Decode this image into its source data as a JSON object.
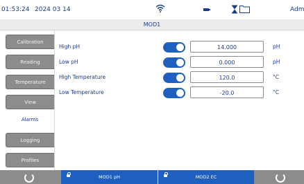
{
  "status": {
    "time": "01:53:24",
    "date": "2024 03 14",
    "user": "Adm"
  },
  "icons": {
    "wifi": "wifi-icon",
    "battery": "battery-icon",
    "hourglass": "hourglass-icon",
    "folder": "folder-icon"
  },
  "title": "MOD1",
  "sidebar": {
    "items": [
      {
        "label": "Calibration"
      },
      {
        "label": "Reading"
      },
      {
        "label": "Temperature"
      },
      {
        "label": "View"
      },
      {
        "label": "Alarms"
      },
      {
        "label": "Logging"
      },
      {
        "label": "Profiles"
      }
    ]
  },
  "alarms": [
    {
      "label": "High pH",
      "value": "14.000",
      "unit": "pH",
      "enabled": true
    },
    {
      "label": "Low pH",
      "value": "0.000",
      "unit": "pH",
      "enabled": true
    },
    {
      "label": "High Temperature",
      "value": "120.0",
      "unit": "°C",
      "enabled": true
    },
    {
      "label": "Low Temperature",
      "value": "-20.0",
      "unit": "°C",
      "enabled": true
    }
  ],
  "bottom": {
    "sensor1": "MOD1 pH",
    "sensor2": "MOD2 EC"
  },
  "colors": {
    "accent": "#1f5fbf",
    "text": "#1a3a8a",
    "tab": "#8c8c8c"
  }
}
